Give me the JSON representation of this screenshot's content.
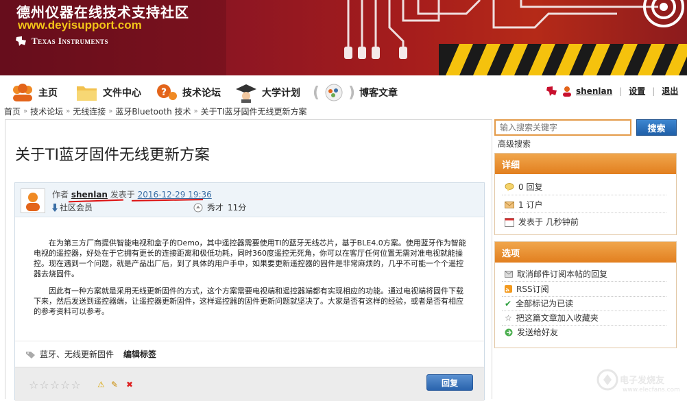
{
  "banner": {
    "title": "德州仪器在线技术支持社区",
    "url": "www.deyisupport.com",
    "brand": "Texas Instruments"
  },
  "nav": {
    "items": [
      {
        "label": "主页",
        "icon": "people-group-icon"
      },
      {
        "label": "文件中心",
        "icon": "folder-icon"
      },
      {
        "label": "技术论坛",
        "icon": "forum-question-icon"
      },
      {
        "label": "大学计划",
        "icon": "graduation-icon"
      },
      {
        "label": "博客文章",
        "icon": "blog-icon"
      }
    ],
    "user": {
      "name": "shenlan",
      "settings": "设置",
      "logout": "退出"
    }
  },
  "breadcrumb": [
    "首页",
    "技术论坛",
    "无线连接",
    "蓝牙Bluetooth 技术",
    "关于TI蓝牙固件无线更新方案"
  ],
  "post": {
    "title": "关于TI蓝牙固件无线更新方案",
    "author_prefix": "作者",
    "author": "shenlan",
    "posted_prefix": "发表于",
    "date": "2016-12-29 19:36",
    "role": "社区会员",
    "rank": "秀才",
    "points": "11分",
    "paragraph1": "在为第三方厂商提供智能电视和盒子的Demo，其中遥控器需要使用TI的蓝牙无线芯片，基于BLE4.0方案。使用蓝牙作为智能电视的遥控器，好处在于它拥有更长的连接距离和极低功耗，同时360度遥控无死角，你可以在客厅任何位置无需对准电视就能操控。现在遇到一个问题，就是产品出厂后，到了具体的用户手中，如果要更新遥控器的固件是非常麻烦的，几乎不可能一个个遥控器去烧固件。",
    "paragraph2": "因此有一种方案就是采用无线更新固件的方式，这个方案需要电视端和遥控器端都有实现相应的功能。通过电视端将固件下载下来，然后发送到遥控器端，让遥控器更新固件，这样遥控器的固件更新问题就坚决了。大家是否有这样的经验，或者是否有相应的参考资料可以参考。",
    "tags": "蓝牙、无线更新固件",
    "edit_tags": "编辑标签",
    "reply": "回复",
    "rating": 0
  },
  "sidebar": {
    "search_placeholder": "输入搜索关键字",
    "search_button": "搜索",
    "advanced": "高级搜索",
    "details": {
      "title": "详细",
      "replies": "0 回复",
      "subscribers": "1 订户",
      "posted": "发表于 几秒钟前"
    },
    "options": {
      "title": "选项",
      "items": [
        "取消邮件订阅本帖的回复",
        "RSS订阅",
        "全部标记为已读",
        "把这篇文章加入收藏夹",
        "发送给好友"
      ]
    }
  },
  "watermark": {
    "text": "电子发烧友",
    "sub": "www.elecfans.com"
  },
  "colors": {
    "banner": "#8e1622",
    "accent_orange": "#e8891f",
    "button_blue": "#2a64ad",
    "link_blue": "#3a6ea5",
    "annotation_red": "#dd1111"
  }
}
